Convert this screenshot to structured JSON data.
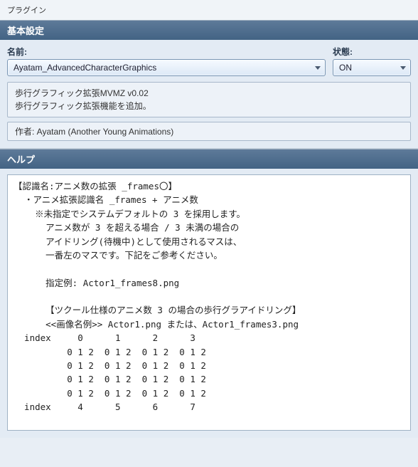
{
  "window": {
    "title": "プラグイン"
  },
  "basic": {
    "header": "基本設定",
    "name_label": "名前:",
    "status_label": "状態:",
    "name_value": "Ayatam_AdvancedCharacterGraphics",
    "status_value": "ON",
    "description_line1": "歩行グラフィック拡張MVMZ v0.02",
    "description_line2": "歩行グラフィック拡張機能を追加。",
    "author": "作者: Ayatam (Another Young Animations)"
  },
  "help": {
    "header": "ヘルプ",
    "text": "【認識名:アニメ数の拡張 _frames〇】\n  ・アニメ拡張認識名 _frames + アニメ数\n    ※未指定でシステムデフォルトの 3 を採用します。\n      アニメ数が 3 を超える場合 / 3 未満の場合の\n      アイドリング(待機中)として使用されるマスは、\n      一番左のマスです。下記をご参考ください。\n\n      指定例: Actor1_frames8.png\n\n      【ツクール仕様のアニメ数 3 の場合の歩行グラアイドリング】\n      <<画像名例>> Actor1.png または、Actor1_frames3.png\n  index     0      1      2      3\n          0 1 2  0 1 2  0 1 2  0 1 2\n          0 1 2  0 1 2  0 1 2  0 1 2\n          0 1 2  0 1 2  0 1 2  0 1 2\n          0 1 2  0 1 2  0 1 2  0 1 2\n  index     4      5      6      7"
  }
}
